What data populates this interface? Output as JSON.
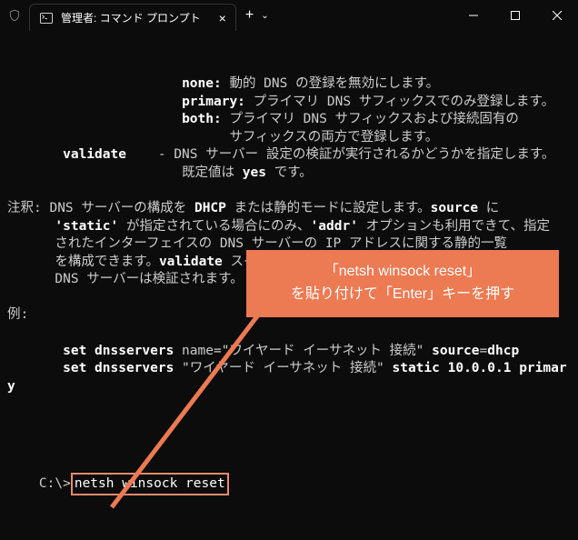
{
  "titlebar": {
    "tab_title": "管理者: コマンド プロンプト"
  },
  "terminal": {
    "lines": [
      "                      none: 動的 DNS の登録を無効にします。",
      "                      primary: プライマリ DNS サフィックスでのみ登録します。",
      "                      both: プライマリ DNS サフィックスおよび接続固有の",
      "                            サフィックスの両方で登録します。",
      "       validate    - DNS サーバー 設定の検証が実行されるかどうかを指定します。",
      "                      既定値は yes です。",
      "",
      "注釈: DNS サーバーの構成を DHCP または静的モードに設定します。source に",
      "      'static' が指定されている場合にのみ、'addr' オプションも利用できて、指定",
      "      されたインターフェイスの DNS サーバーの IP アドレスに関する静的一覧",
      "      を構成できます。validate スイッチが yes の場合、新しく設定された",
      "      DNS サーバーは検証されます。",
      "",
      "例:",
      "",
      "       set dnsservers name=\"ワイヤード イーサネット 接続\" source=dhcp",
      "       set dnsservers \"ワイヤード イーサネット 接続\" static 10.0.0.1 primary",
      ""
    ],
    "prompt": "C:\\>",
    "command": "netsh winsock reset"
  },
  "callout": {
    "line1": "「netsh winsock reset」",
    "line2": "を貼り付けて「Enter」キーを押す"
  }
}
